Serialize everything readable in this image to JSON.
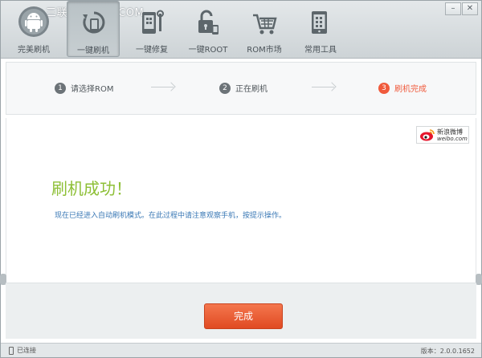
{
  "watermark": "三联网 3LIAN.COM",
  "window_controls": {
    "minimize": "–",
    "close": "✕"
  },
  "toolbar": {
    "items": [
      {
        "label": "完美刷机",
        "icon": "android-icon"
      },
      {
        "label": "一键刷机",
        "icon": "phone-refresh-icon",
        "active": true
      },
      {
        "label": "一键修复",
        "icon": "phone-wrench-icon"
      },
      {
        "label": "一键ROOT",
        "icon": "phone-unlock-icon"
      },
      {
        "label": "ROM市场",
        "icon": "cart-icon"
      },
      {
        "label": "常用工具",
        "icon": "phone-tools-icon"
      }
    ]
  },
  "steps": [
    {
      "num": "1",
      "label": "请选择ROM"
    },
    {
      "num": "2",
      "label": "正在刷机"
    },
    {
      "num": "3",
      "label": "刷机完成",
      "current": true
    }
  ],
  "weibo": {
    "name": "新浪微博",
    "domain": "weibo.com"
  },
  "main": {
    "title": "刷机成功！",
    "description": "现在已经进入自动刷机模式。在此过程中请注意观察手机，按提示操作。"
  },
  "finish_button": "完成",
  "status": {
    "connection": "已连接",
    "version": "版本：2.0.0.1652"
  },
  "colors": {
    "accent": "#f05a3c",
    "success": "#8dbf35",
    "link": "#3a78b5"
  }
}
